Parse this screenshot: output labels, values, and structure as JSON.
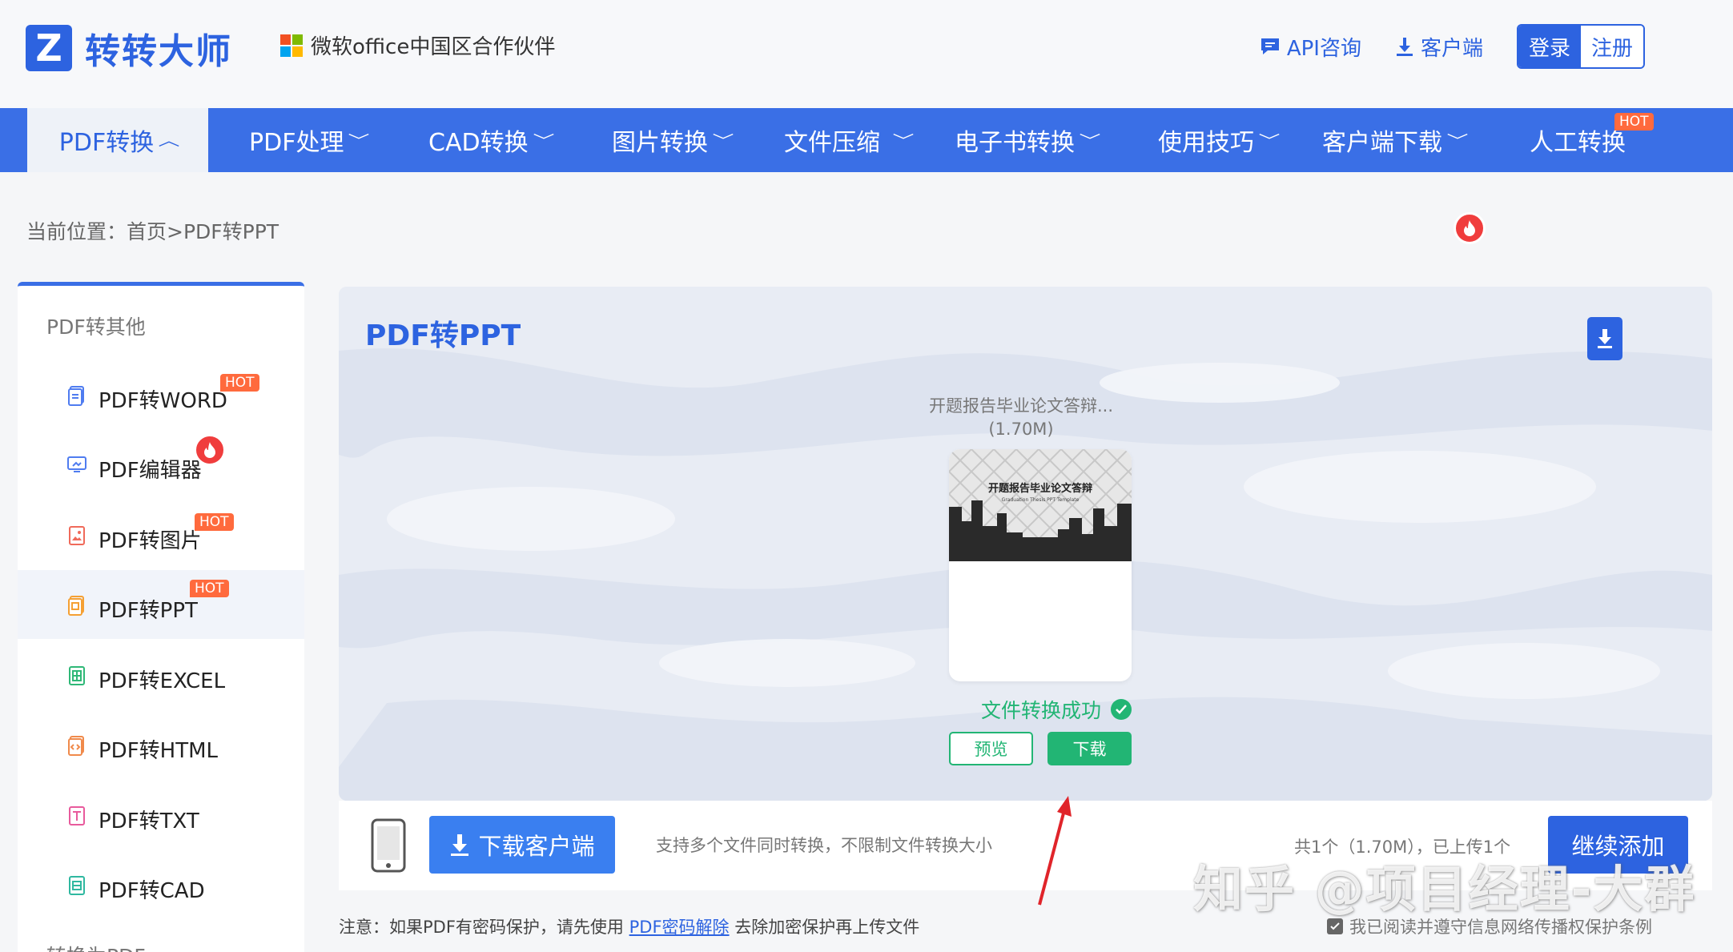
{
  "brand": {
    "logo_letter": "Z",
    "name": "转转大师",
    "partner": "微软office中国区合作伙伴"
  },
  "top_links": {
    "api": "API咨询",
    "client": "客户端",
    "login": "登录",
    "register": "注册"
  },
  "nav": [
    {
      "label": "PDF转换",
      "active": true
    },
    {
      "label": "PDF处理"
    },
    {
      "label": "CAD转换"
    },
    {
      "label": "图片转换"
    },
    {
      "label": "文件压缩"
    },
    {
      "label": "电子书转换"
    },
    {
      "label": "使用技巧"
    },
    {
      "label": "客户端下载"
    },
    {
      "label": "人工转换",
      "badge": "HOT"
    }
  ],
  "breadcrumb": "当前位置：首页>PDF转PPT",
  "sidebar": {
    "heading": "PDF转其他",
    "items": [
      {
        "label": "PDF转WORD",
        "badge": "HOT"
      },
      {
        "label": "PDF编辑器",
        "badge": "fire"
      },
      {
        "label": "PDF转图片",
        "badge": "HOT"
      },
      {
        "label": "PDF转PPT",
        "badge": "HOT",
        "active": true
      },
      {
        "label": "PDF转EXCEL"
      },
      {
        "label": "PDF转HTML"
      },
      {
        "label": "PDF转TXT"
      },
      {
        "label": "PDF转CAD"
      }
    ],
    "footer_heading": "转换为PDF"
  },
  "main": {
    "title": "PDF转PPT",
    "file_name": "开题报告毕业论文答辩...",
    "file_size": "(1.70M)",
    "thumb_title": "开题报告毕业论文答辩",
    "thumb_sub": "Graduation Thesis PPT Template",
    "status": "文件转换成功",
    "preview": "预览",
    "download": "下载"
  },
  "bottom": {
    "download_client": "下载客户端",
    "support": "支持多个文件同时转换，不限制文件转换大小",
    "count": "共1个（1.70M），已上传1个",
    "continue": "继续添加"
  },
  "notice": {
    "prefix": "注意：如果PDF有密码保护，请先使用",
    "link": "PDF密码解除",
    "suffix": "去除加密保护再上传文件"
  },
  "agree": "我已阅读并遵守信息网络传播权保护条例",
  "watermark": "知乎 @项目经理-大群",
  "colors": {
    "brand_blue": "#2d63e0",
    "nav_blue": "#3a6fe6",
    "success_green": "#22b574",
    "hot_orange": "#ff6a3d",
    "fire_red": "#f03d3d"
  }
}
